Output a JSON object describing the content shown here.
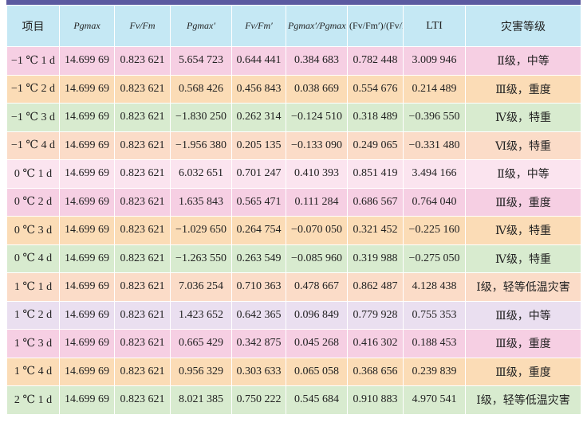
{
  "table": {
    "headers": [
      "项目",
      "Pgmax",
      "Fv/Fm",
      "Pgmax′",
      "Fv/Fm′",
      "Pgmax′/Pgmax",
      "(Fv/Fm′)/(Fv/Fm)",
      "LTI",
      "灾害等级"
    ],
    "header_line2": "(Fv/Fm)",
    "rows": [
      {
        "style": "pink",
        "cells": [
          "−1 ℃ 1 d",
          "14.699 69",
          "0.823 621",
          "5.654 723",
          "0.644 441",
          "0.384 683",
          "0.782 448",
          "3.009 946",
          "Ⅱ级，中等"
        ]
      },
      {
        "style": "peach",
        "cells": [
          "−1 ℃ 2 d",
          "14.699 69",
          "0.823 621",
          "0.568 426",
          "0.456 843",
          "0.038 669",
          "0.554 676",
          "0.214 489",
          "Ⅲ级，重度"
        ]
      },
      {
        "style": "green",
        "cells": [
          "−1 ℃ 3 d",
          "14.699 69",
          "0.823 621",
          "−1.830 250",
          "0.262 314",
          "−0.124 510",
          "0.318 489",
          "−0.396 550",
          "Ⅳ级，特重"
        ]
      },
      {
        "style": "salmon",
        "cells": [
          "−1 ℃ 4 d",
          "14.699 69",
          "0.823 621",
          "−1.956 380",
          "0.205 135",
          "−0.133 090",
          "0.249 065",
          "−0.331 480",
          "Ⅵ级，特重"
        ]
      },
      {
        "style": "lightpink",
        "cells": [
          "0 ℃ 1 d",
          "14.699 69",
          "0.823 621",
          "6.032 651",
          "0.701 247",
          "0.410 393",
          "0.851 419",
          "3.494 166",
          "Ⅱ级，中等"
        ]
      },
      {
        "style": "pink",
        "cells": [
          "0 ℃ 2 d",
          "14.699 69",
          "0.823 621",
          "1.635 843",
          "0.565 471",
          "0.111 284",
          "0.686 567",
          "0.764 040",
          "Ⅲ级，重度"
        ]
      },
      {
        "style": "peach",
        "cells": [
          "0 ℃ 3 d",
          "14.699 69",
          "0.823 621",
          "−1.029 650",
          "0.264 754",
          "−0.070 050",
          "0.321 452",
          "−0.225 160",
          "Ⅳ级，特重"
        ]
      },
      {
        "style": "green",
        "cells": [
          "0 ℃ 4 d",
          "14.699 69",
          "0.823 621",
          "−1.263 550",
          "0.263 549",
          "−0.085 960",
          "0.319 988",
          "−0.275 050",
          "Ⅳ级，特重"
        ]
      },
      {
        "style": "salmon",
        "cells": [
          "1 ℃ 1 d",
          "14.699 69",
          "0.823 621",
          "7.036 254",
          "0.710 363",
          "0.478 667",
          "0.862 487",
          "4.128 438",
          "Ⅰ级，轻等低温灾害"
        ]
      },
      {
        "style": "lavender",
        "cells": [
          "1 ℃ 2 d",
          "14.699 69",
          "0.823 621",
          "1.423 652",
          "0.642 365",
          "0.096 849",
          "0.779 928",
          "0.755 353",
          "Ⅲ级，中等"
        ]
      },
      {
        "style": "pink",
        "cells": [
          "1 ℃ 3 d",
          "14.699 69",
          "0.823 621",
          "0.665 429",
          "0.342 875",
          "0.045 268",
          "0.416 302",
          "0.188 453",
          "Ⅲ级，重度"
        ]
      },
      {
        "style": "peach",
        "cells": [
          "1 ℃ 4 d",
          "14.699 69",
          "0.823 621",
          "0.956 329",
          "0.303 633",
          "0.065 058",
          "0.368 656",
          "0.239 839",
          "Ⅲ级，重度"
        ]
      },
      {
        "style": "green",
        "cells": [
          "2 ℃ 1 d",
          "14.699 69",
          "0.823 621",
          "8.021 385",
          "0.750 222",
          "0.545 684",
          "0.910 883",
          "4.970 541",
          "Ⅰ级，轻等低温灾害"
        ]
      }
    ]
  }
}
